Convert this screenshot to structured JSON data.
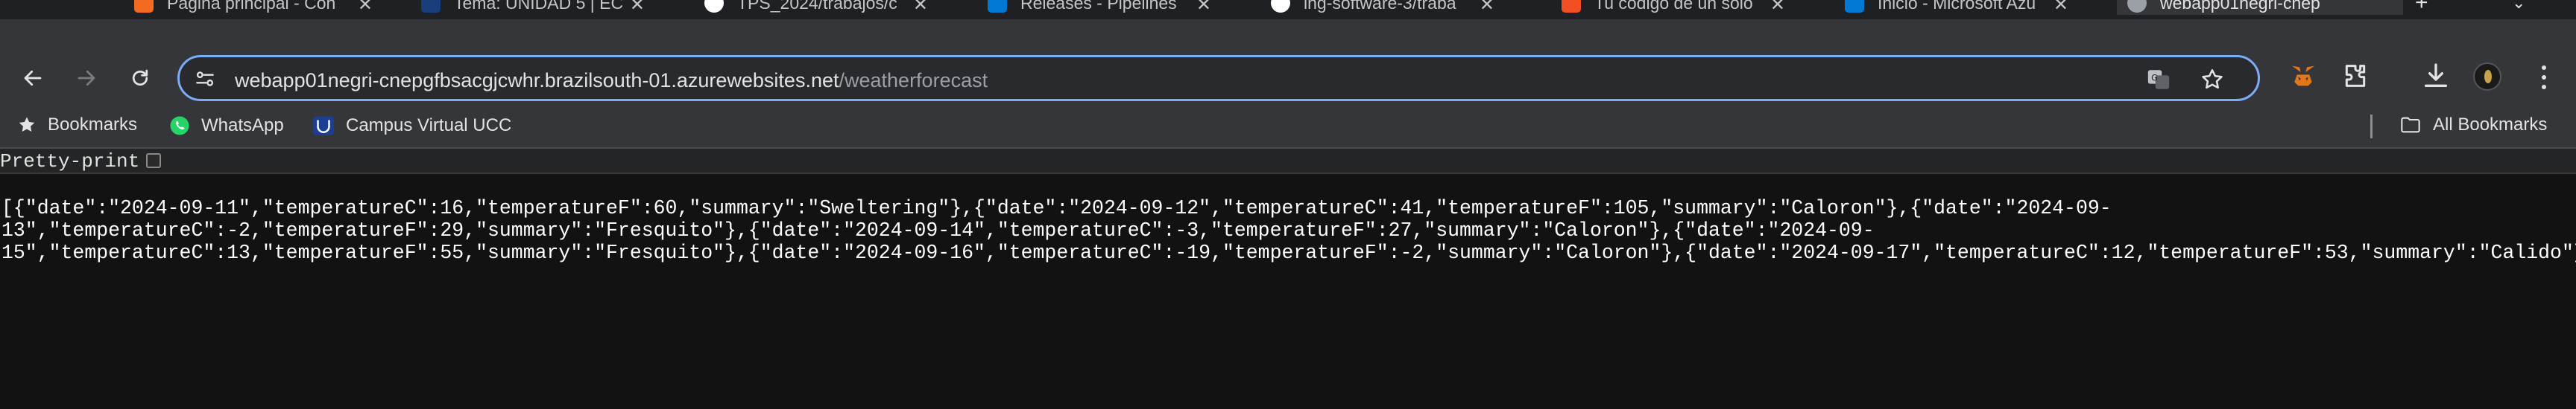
{
  "tabs": [
    {
      "title": "Página principal - Con",
      "favicon_color": "#f26b21",
      "active": false
    },
    {
      "title": "Tema: UNIDAD 5 | EC",
      "favicon_color": "#1a3d7c",
      "active": false
    },
    {
      "title": "TPS_2024/trabajos/c",
      "favicon_color": "#ffffff",
      "active": false
    },
    {
      "title": "Releases - Pipelines",
      "favicon_color": "#0078d4",
      "active": false
    },
    {
      "title": "ing-software-3/traba",
      "favicon_color": "#ffffff",
      "active": false
    },
    {
      "title": "Tu código de un solo",
      "favicon_color": "#f25022",
      "active": false
    },
    {
      "title": "Inicio - Microsoft Azu",
      "favicon_color": "#0078d4",
      "active": false
    },
    {
      "title": "webapp01negri-cnep",
      "favicon_color": "#9aa0a6",
      "active": true
    }
  ],
  "address_bar": {
    "host": "webapp01negri-cnepgfbsacgjcwhr.brazilsouth-01.azurewebsites.net",
    "path": "/weatherforecast"
  },
  "bookmarks_bar": {
    "items": [
      {
        "label": "Bookmarks",
        "icon": "star-icon"
      },
      {
        "label": "WhatsApp",
        "icon": "whatsapp-icon"
      },
      {
        "label": "Campus Virtual UCC",
        "icon": "ucc-icon"
      }
    ],
    "all_bookmarks": "All Bookmarks"
  },
  "pretty_print": {
    "label": "Pretty-print",
    "checked": false
  },
  "json_body": {
    "lines": [
      "[{\"date\":\"2024-09-11\",\"temperatureC\":16,\"temperatureF\":60,\"summary\":\"Sweltering\"},{\"date\":\"2024-09-12\",\"temperatureC\":41,\"temperatureF\":105,\"summary\":\"Caloron\"},{\"date\":\"2024-09-",
      "13\",\"temperatureC\":-2,\"temperatureF\":29,\"summary\":\"Fresquito\"},{\"date\":\"2024-09-14\",\"temperatureC\":-3,\"temperatureF\":27,\"summary\":\"Caloron\"},{\"date\":\"2024-09-",
      "15\",\"temperatureC\":13,\"temperatureF\":55,\"summary\":\"Fresquito\"},{\"date\":\"2024-09-16\",\"temperatureC\":-19,\"temperatureF\":-2,\"summary\":\"Caloron\"},{\"date\":\"2024-09-17\",\"temperatureC\":12,\"temperatureF\":53,\"summary\":\"Calido\"}]"
    ]
  },
  "colors": {
    "omnibox_border": "#7cacf8",
    "toolbar_bg": "#35363a",
    "page_bg": "#121212"
  }
}
